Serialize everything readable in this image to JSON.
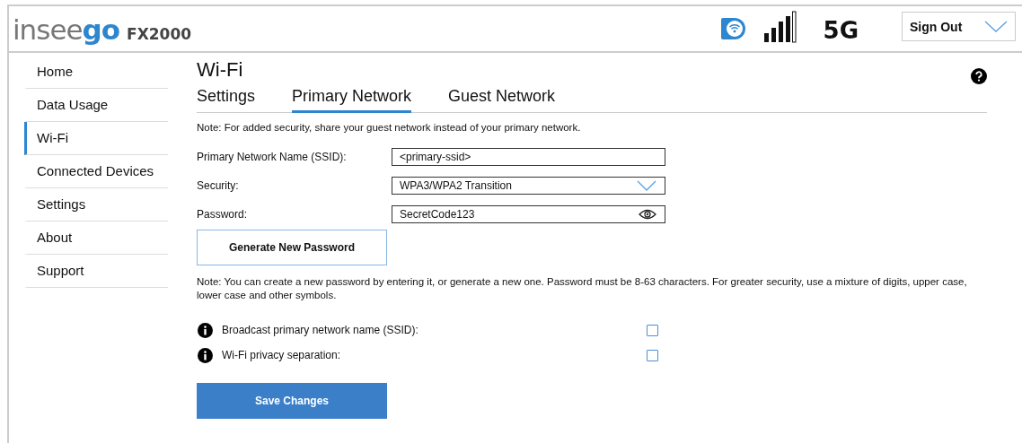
{
  "header": {
    "logo": [
      {
        "text": "insee",
        "accent": false
      },
      {
        "text": "go",
        "accent": true
      }
    ],
    "model": "FX2000",
    "network_type": "5G",
    "sign_out": "Sign Out"
  },
  "sidebar": {
    "items": [
      {
        "label": "Home",
        "selected": false
      },
      {
        "label": "Data Usage",
        "selected": false
      },
      {
        "label": "Wi-Fi",
        "selected": true
      },
      {
        "label": "Connected Devices",
        "selected": false
      },
      {
        "label": "Settings",
        "selected": false
      },
      {
        "label": "About",
        "selected": false
      },
      {
        "label": "Support",
        "selected": false
      }
    ]
  },
  "page": {
    "title": "Wi-Fi",
    "tabs": [
      {
        "label": "Settings",
        "selected": false
      },
      {
        "label": "Primary Network",
        "selected": true
      },
      {
        "label": "Guest Network",
        "selected": false
      }
    ],
    "note": "Note: For added security, share your guest network instead of your primary network.",
    "fields": [
      {
        "kind": "text",
        "label": "Primary Network Name (SSID):",
        "value": "<primary-ssid>"
      },
      {
        "kind": "select",
        "label": "Security:",
        "value": "WPA3/WPA2 Transition"
      },
      {
        "kind": "password",
        "label": "Password:",
        "value": "SecretCode123"
      }
    ],
    "generate_button": "Generate New Password",
    "password_note": "Note: You can create a new password by entering it, or generate a new one. Password must be 8-63 characters. For greater security, use a mixture of digits, upper case, lower case and other symbols.",
    "options": [
      {
        "label": "Broadcast primary network name (SSID):",
        "checked": false
      },
      {
        "label": "Wi-Fi privacy separation:",
        "checked": false
      }
    ],
    "save_button": "Save Changes"
  }
}
